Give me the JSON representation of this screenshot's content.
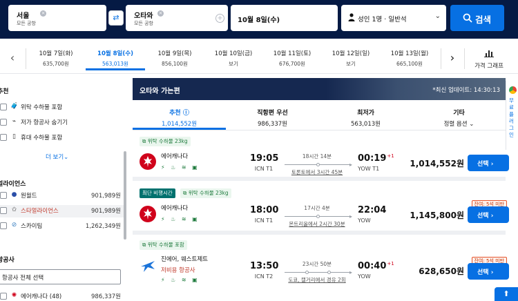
{
  "search": {
    "origin": {
      "city": "서울",
      "sub": "모든 공항"
    },
    "destination": {
      "city": "오타와",
      "sub": "모든 공항"
    },
    "date": "10월 8일(수)",
    "passengers": "성인 1명 · 일반석",
    "search_label": "검색"
  },
  "dates": [
    {
      "label": "10월 7일(화)",
      "price": "635,700원"
    },
    {
      "label": "10월 8일(수)",
      "price": "563,013원",
      "selected": true
    },
    {
      "label": "10월 9일(목)",
      "price": "856,100원"
    },
    {
      "label": "10월 10일(금)",
      "price": "보기"
    },
    {
      "label": "10월 11일(토)",
      "price": "676,700원"
    },
    {
      "label": "10월 12일(일)",
      "price": "보기"
    },
    {
      "label": "10월 13일(월)",
      "price": "665,100원"
    }
  ],
  "price_graph_label": "가격 그래프",
  "filters": {
    "recommended_heading": "추천",
    "recommended": [
      {
        "label": "위탁 수하물 포함",
        "icon": "luggage-icon"
      },
      {
        "label": "저가 항공사 숨기기",
        "icon": "tag-icon"
      },
      {
        "label": "휴대 수하물 포함",
        "icon": "carry-on-icon"
      }
    ],
    "more_label": "더 보기",
    "alliances_heading": "얼라이언스",
    "alliances": [
      {
        "label": "원월드",
        "price": "901,989원"
      },
      {
        "label": "스타얼라이언스",
        "price": "901,989원"
      },
      {
        "label": "스카이팀",
        "price": "1,262,349원"
      }
    ],
    "airlines_heading": "항공사",
    "select_all_label": "항공사 전체 선택",
    "airlines": [
      {
        "label": "에어캐나다 (48)",
        "price": "986,337원"
      }
    ]
  },
  "results": {
    "header_title": "오타와 가는편",
    "header_update": "*최신 업데이트: 14:30:13",
    "tabs": [
      {
        "label": "추천",
        "value": "1,014,552원"
      },
      {
        "label": "직항편 우선",
        "value": "986,337원"
      },
      {
        "label": "최저가",
        "value": "563,013원"
      },
      {
        "label": "기타",
        "value": "정렬 옵션"
      }
    ],
    "flights": [
      {
        "badges": [
          "위탁 수하물 23kg"
        ],
        "airline": "에어캐나다",
        "sub_airline": "",
        "dep_time": "19:05",
        "dep_airport": "ICN T1",
        "duration": "18시간 14분",
        "via": "토론토에서 3시간 45분",
        "arr_time": "00:19",
        "arr_plus": "+1",
        "arr_airport": "YOW T1",
        "price": "1,014,552원",
        "seats_left": "",
        "select_label": "선택"
      },
      {
        "badges": [
          "최단 비행시간",
          "위탁 수하물 23kg"
        ],
        "airline": "에어캐나다",
        "sub_airline": "",
        "dep_time": "18:00",
        "dep_airport": "ICN T1",
        "duration": "17시간 4분",
        "via": "몬트리올에서 2시간 30분",
        "arr_time": "22:04",
        "arr_plus": "",
        "arr_airport": "YOW",
        "price": "1,145,800원",
        "seats_left": "잔여: 5석 미만",
        "select_label": "선택"
      },
      {
        "badges": [
          "위탁 수하물 포함"
        ],
        "airline": "진에어, 웨스트제트",
        "sub_airline": "저비용 항공사",
        "dep_time": "13:50",
        "dep_airport": "ICN T2",
        "duration": "23시간 50분",
        "via": "도쿄, 캘거리에서 경유 2회",
        "arr_time": "00:40",
        "arr_plus": "+1",
        "arr_airport": "YOW",
        "price": "628,650원",
        "seats_left": "잔여: 5석 미만",
        "select_label": "선택"
      }
    ]
  },
  "side_extension_label": "무료 플러그인",
  "colors": {
    "accent": "#0770e3",
    "nav_bg": "#051a44",
    "bag_green": "#1d7a3c",
    "short_badge": "#00716e"
  }
}
